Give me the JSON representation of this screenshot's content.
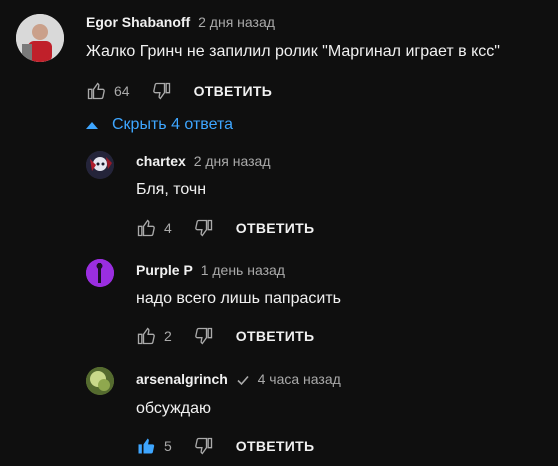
{
  "comments": [
    {
      "author": "Egor Shabanoff",
      "time": "2 дня назад",
      "text": "Жалко Гринч не запилил ролик \"Маргинал играет в ксс\"",
      "likes": "64",
      "reply_label": "ОТВЕТИТЬ"
    }
  ],
  "replies_toggle": {
    "label": "Скрыть 4 ответа"
  },
  "replies": [
    {
      "author": "chartex",
      "time": "2 дня назад",
      "text": "Бля, точн",
      "likes": "4",
      "reply_label": "ОТВЕТИТЬ"
    },
    {
      "author": "Purple P",
      "time": "1 день назад",
      "text": "надо всего лишь папрасить",
      "likes": "2",
      "reply_label": "ОТВЕТИТЬ"
    },
    {
      "author": "arsenalgrinch",
      "time": "4 часа назад",
      "text": "обсуждаю",
      "likes": "5",
      "reply_label": "ОТВЕТИТЬ",
      "verified": true,
      "liked": true
    }
  ],
  "colors": {
    "background": "#0f0f0f",
    "link_blue": "#3ea6ff",
    "secondary_text": "#aaaaaa",
    "liked_blue": "#3ea6ff"
  }
}
